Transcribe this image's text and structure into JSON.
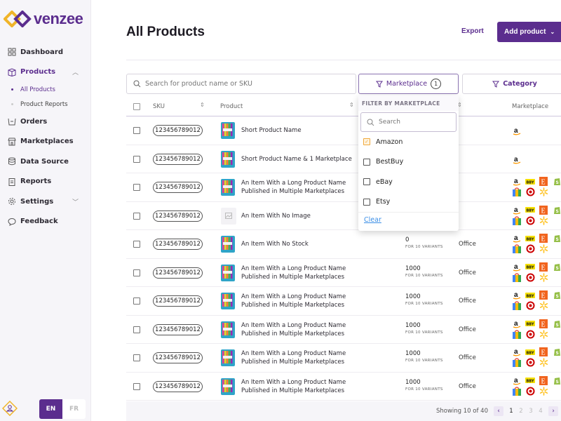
{
  "brand": {
    "name": "venzee",
    "accent": "#5b2d8e"
  },
  "sidebar": {
    "items": [
      {
        "label": "Dashboard",
        "icon": "grid-icon"
      },
      {
        "label": "Products",
        "icon": "box-icon",
        "active": true,
        "expanded": true,
        "children": [
          {
            "label": "All Products",
            "active": true
          },
          {
            "label": "Product Reports"
          }
        ]
      },
      {
        "label": "Orders",
        "icon": "tray-icon"
      },
      {
        "label": "Marketplaces",
        "icon": "storefront-icon"
      },
      {
        "label": "Data Source",
        "icon": "database-icon"
      },
      {
        "label": "Reports",
        "icon": "clipboard-icon"
      },
      {
        "label": "Settings",
        "icon": "gear-icon"
      },
      {
        "label": "Feedback",
        "icon": "chat-bubble-icon"
      }
    ],
    "languages": {
      "en": "EN",
      "fr": "FR",
      "selected": "EN"
    }
  },
  "header": {
    "title": "All Products",
    "export_label": "Export",
    "add_label": "Add product"
  },
  "filters": {
    "search_placeholder": "Search for product name or SKU",
    "marketplace_label": "Marketplace",
    "marketplace_count": "1",
    "category_label": "Category"
  },
  "table": {
    "columns": {
      "sku": "SKU",
      "product": "Product",
      "marketplace": "Marketplace"
    },
    "rows": [
      {
        "sku": "123456789012",
        "name": "Short Product Name",
        "image": true,
        "marketplaces": [
          "amazon"
        ]
      },
      {
        "sku": "123456789012",
        "name": "Short Product Name & 1 Marketplace",
        "image": true,
        "marketplaces": [
          "amazon"
        ]
      },
      {
        "sku": "123456789012",
        "name": "An Item With a Long Product Name Published in Multiple Marketplaces",
        "image": true,
        "marketplaces": [
          "amazon",
          "bestbuy",
          "etsy",
          "shopify",
          "google-shopping",
          "target",
          "walmart"
        ]
      },
      {
        "sku": "123456789012",
        "name": "An Item With No Image",
        "image": false,
        "marketplaces": [
          "amazon",
          "bestbuy",
          "etsy",
          "shopify",
          "google-shopping",
          "target",
          "walmart"
        ]
      },
      {
        "sku": "123456789012",
        "name": "An Item With No Stock",
        "image": true,
        "stock": "0",
        "variants": "FOR 10 VARIANTS",
        "category": "Office",
        "marketplaces": [
          "amazon",
          "bestbuy",
          "etsy",
          "shopify",
          "google-shopping",
          "target",
          "walmart"
        ]
      },
      {
        "sku": "123456789012",
        "name": "An Item With a Long Product Name Published in Multiple Marketplaces",
        "image": true,
        "stock": "1000",
        "variants": "FOR 10 VARIANTS",
        "category": "Office",
        "marketplaces": [
          "amazon",
          "bestbuy",
          "etsy",
          "shopify",
          "google-shopping",
          "target",
          "walmart"
        ]
      },
      {
        "sku": "123456789012",
        "name": "An Item With a Long Product Name Published in Multiple Marketplaces",
        "image": true,
        "stock": "1000",
        "variants": "FOR 10 VARIANTS",
        "category": "Office",
        "marketplaces": [
          "amazon",
          "bestbuy",
          "etsy",
          "shopify",
          "google-shopping",
          "target",
          "walmart"
        ]
      },
      {
        "sku": "123456789012",
        "name": "An Item With a Long Product Name Published in Multiple Marketplaces",
        "image": true,
        "stock": "1000",
        "variants": "FOR 10 VARIANTS",
        "category": "Office",
        "marketplaces": [
          "amazon",
          "bestbuy",
          "etsy",
          "shopify",
          "google-shopping",
          "target",
          "walmart"
        ]
      },
      {
        "sku": "123456789012",
        "name": "An Item With a Long Product Name Published in Multiple Marketplaces",
        "image": true,
        "stock": "1000",
        "variants": "FOR 10 VARIANTS",
        "category": "Office",
        "marketplaces": [
          "amazon",
          "bestbuy",
          "etsy",
          "shopify",
          "google-shopping",
          "target",
          "walmart"
        ]
      },
      {
        "sku": "123456789012",
        "name": "An Item With a Long Product Name Published in Multiple Marketplaces",
        "image": true,
        "stock": "1000",
        "variants": "FOR 10 VARIANTS",
        "category": "Office",
        "marketplaces": [
          "amazon",
          "bestbuy",
          "etsy",
          "shopify",
          "google-shopping",
          "target",
          "walmart"
        ]
      }
    ]
  },
  "dropdown": {
    "heading": "FILTER BY MARKETPLACE",
    "search_placeholder": "Search",
    "options": [
      {
        "label": "Amazon",
        "checked": true
      },
      {
        "label": "BestBuy",
        "checked": false
      },
      {
        "label": "eBay",
        "checked": false
      },
      {
        "label": "Etsy",
        "checked": false
      }
    ],
    "clear_label": "Clear"
  },
  "pagination": {
    "summary": "Showing 10 of 40",
    "pages": [
      "1",
      "2",
      "3",
      "4"
    ],
    "current": "1"
  }
}
